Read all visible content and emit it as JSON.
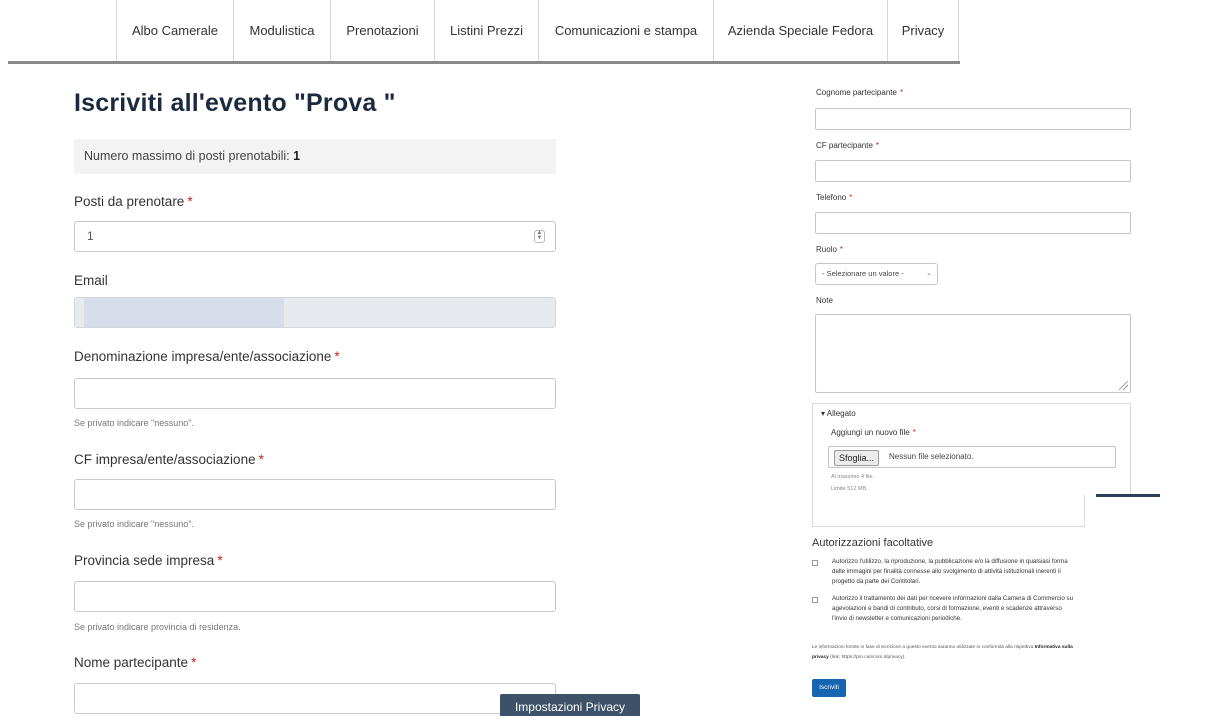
{
  "nav": {
    "items": [
      {
        "label": "Albo Camerale"
      },
      {
        "label": "Modulistica"
      },
      {
        "label": "Prenotazioni"
      },
      {
        "label": "Listini Prezzi"
      },
      {
        "label": "Comunicazioni e stampa"
      },
      {
        "label": "Azienda Speciale Fedora"
      },
      {
        "label": "Privacy"
      }
    ]
  },
  "form": {
    "title": "Iscriviti all'evento \"Prova \"",
    "max_seats_label": "Numero massimo di posti prenotabili:",
    "max_seats_value": "1",
    "required_marker": "*",
    "posti": {
      "label": "Posti da prenotare",
      "value": "1"
    },
    "email": {
      "label": "Email"
    },
    "denominazione": {
      "label": "Denominazione impresa/ente/associazione",
      "help": "Se privato indicare \"nessuno\"."
    },
    "cf_impresa": {
      "label": "CF impresa/ente/associazione",
      "help": "Se privato indicare \"nessuno\"."
    },
    "provincia": {
      "label": "Provincia sede impresa",
      "help": "Se privato indicare provincia di residenza."
    },
    "nome": {
      "label": "Nome partecipante"
    }
  },
  "privacy_button": "Impostazioni Privacy",
  "right": {
    "cognome": {
      "label": "Cognome partecipante"
    },
    "cf_partecipante": {
      "label": "CF partecipante"
    },
    "telefono": {
      "label": "Telefono"
    },
    "ruolo": {
      "label": "Ruolo",
      "selected": "- Selezionare un valore -"
    },
    "note": {
      "label": "Note"
    },
    "allegato": {
      "summary": "▾ Allegato",
      "label": "Aggiungi un nuovo file",
      "browse_button": "Sfoglia...",
      "no_file": "Nessun file selezionato.",
      "limit_files": "Al massimo 4 file.",
      "limit_size": "Limite 512 MB."
    },
    "autorizzazioni": {
      "title": "Autorizzazioni facoltative",
      "items": [
        {
          "text": "Autorizzo l'utilizzo, la riproduzione, la pubblicazione e/o la diffusione in qualsiasi forma delle immagini per finalità connesse allo svolgimento di attività istituzionali inerenti il progetto da parte dei Contitolari."
        },
        {
          "text": "Autorizzo il trattamento dei dati per ricevere informazioni dalla Camera di Commercio su agevolazioni e bandi di contributo, corsi di formazione, eventi e scadenze attraverso l'invio di newsletter e comunicazioni periodiche."
        }
      ],
      "note_prefix": "Le informazioni fornite in fase di iscrizione a questo evento saranno utilizzate in conformità alla rispettiva",
      "note_link": "Informativa sulla privacy",
      "note_suffix": "(link: https://pro.camcom.it/privacy)."
    },
    "submit": "Iscriviti"
  }
}
